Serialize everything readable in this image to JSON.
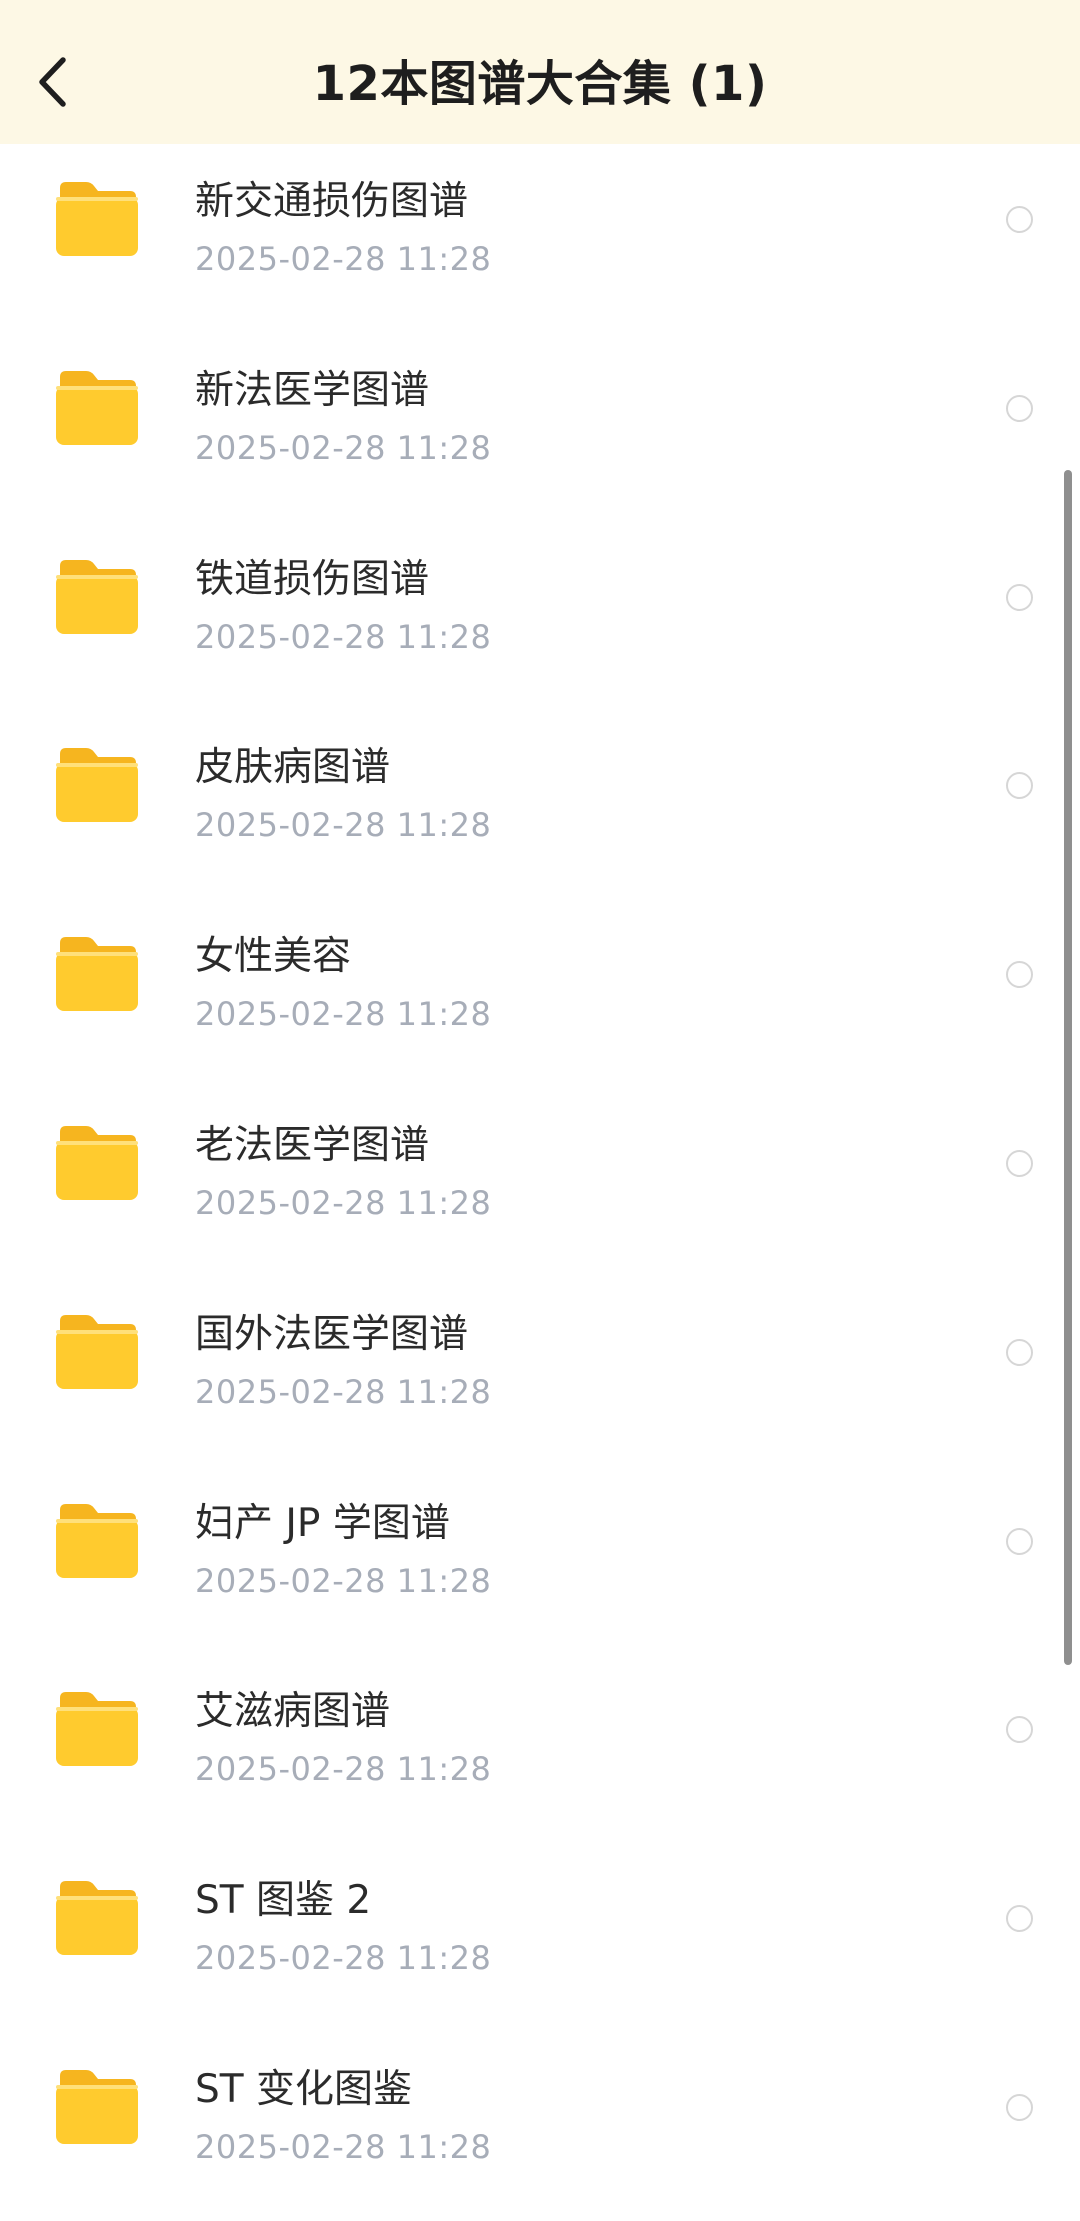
{
  "header": {
    "title": "12本图谱大合集 (1)"
  },
  "colors": {
    "header_bg": "#fdf8e5",
    "folder": "#ffcb2e",
    "name_text": "#2b2b2b",
    "date_text": "#a7adb8"
  },
  "items": [
    {
      "name": "新交通损伤图谱",
      "date": "2025-02-28 11:28",
      "icon": "folder-icon"
    },
    {
      "name": "新法医学图谱",
      "date": "2025-02-28 11:28",
      "icon": "folder-icon"
    },
    {
      "name": "铁道损伤图谱",
      "date": "2025-02-28 11:28",
      "icon": "folder-icon"
    },
    {
      "name": "皮肤病图谱",
      "date": "2025-02-28 11:28",
      "icon": "folder-icon"
    },
    {
      "name": "女性美容",
      "date": "2025-02-28 11:28",
      "icon": "folder-icon"
    },
    {
      "name": "老法医学图谱",
      "date": "2025-02-28 11:28",
      "icon": "folder-icon"
    },
    {
      "name": "国外法医学图谱",
      "date": "2025-02-28 11:28",
      "icon": "folder-icon"
    },
    {
      "name": "妇产 JP 学图谱",
      "date": "2025-02-28 11:28",
      "icon": "folder-icon"
    },
    {
      "name": "艾滋病图谱",
      "date": "2025-02-28 11:28",
      "icon": "folder-icon"
    },
    {
      "name": "ST 图鉴 2",
      "date": "2025-02-28 11:28",
      "icon": "folder-icon"
    },
    {
      "name": "ST 变化图鉴",
      "date": "2025-02-28 11:28",
      "icon": "folder-icon"
    }
  ]
}
